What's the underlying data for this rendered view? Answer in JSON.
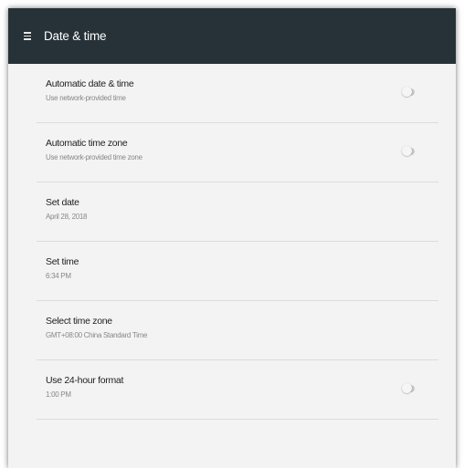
{
  "appbar": {
    "title": "Date & time",
    "menu_icon": "hamburger-menu-icon",
    "background": "#263238"
  },
  "settings": [
    {
      "title": "Automatic date & time",
      "subtitle": "Use network-provided time",
      "has_toggle": true,
      "toggle_on": false
    },
    {
      "title": "Automatic time zone",
      "subtitle": "Use network-provided time zone",
      "has_toggle": true,
      "toggle_on": false
    },
    {
      "title": "Set date",
      "subtitle": "April 28, 2018",
      "has_toggle": false
    },
    {
      "title": "Set time",
      "subtitle": "6:34 PM",
      "has_toggle": false
    },
    {
      "title": "Select time zone",
      "subtitle": "GMT+08:00 China Standard Time",
      "has_toggle": false
    },
    {
      "title": "Use 24-hour format",
      "subtitle": "1:00 PM",
      "has_toggle": true,
      "toggle_on": false
    }
  ]
}
